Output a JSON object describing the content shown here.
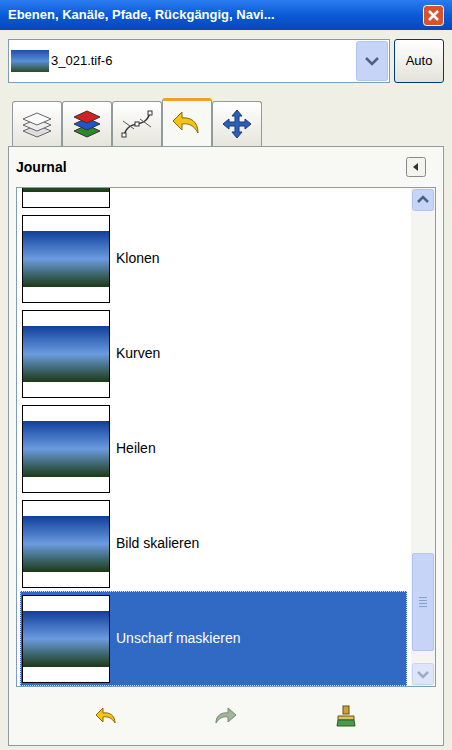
{
  "window": {
    "title": "Ebenen, Kanäle, Pfade, Rückgängig, Navi..."
  },
  "image_menu": {
    "value": "3_021.tif-6"
  },
  "auto_button": "Auto",
  "tabs": [
    {
      "kind": "layers",
      "selected": false
    },
    {
      "kind": "channels",
      "selected": false
    },
    {
      "kind": "paths",
      "selected": false
    },
    {
      "kind": "undo",
      "selected": true
    },
    {
      "kind": "navigation",
      "selected": false
    }
  ],
  "panel": {
    "title": "Journal"
  },
  "history": [
    {
      "label": "",
      "selected": false
    },
    {
      "label": "Klonen",
      "selected": false
    },
    {
      "label": "Kurven",
      "selected": false
    },
    {
      "label": "Heilen",
      "selected": false
    },
    {
      "label": "Bild skalieren",
      "selected": false
    },
    {
      "label": "Unscharf maskieren",
      "selected": true
    }
  ],
  "buttons": [
    {
      "kind": "undo",
      "disabled": false
    },
    {
      "kind": "redo",
      "disabled": true
    },
    {
      "kind": "clear",
      "disabled": false
    }
  ]
}
